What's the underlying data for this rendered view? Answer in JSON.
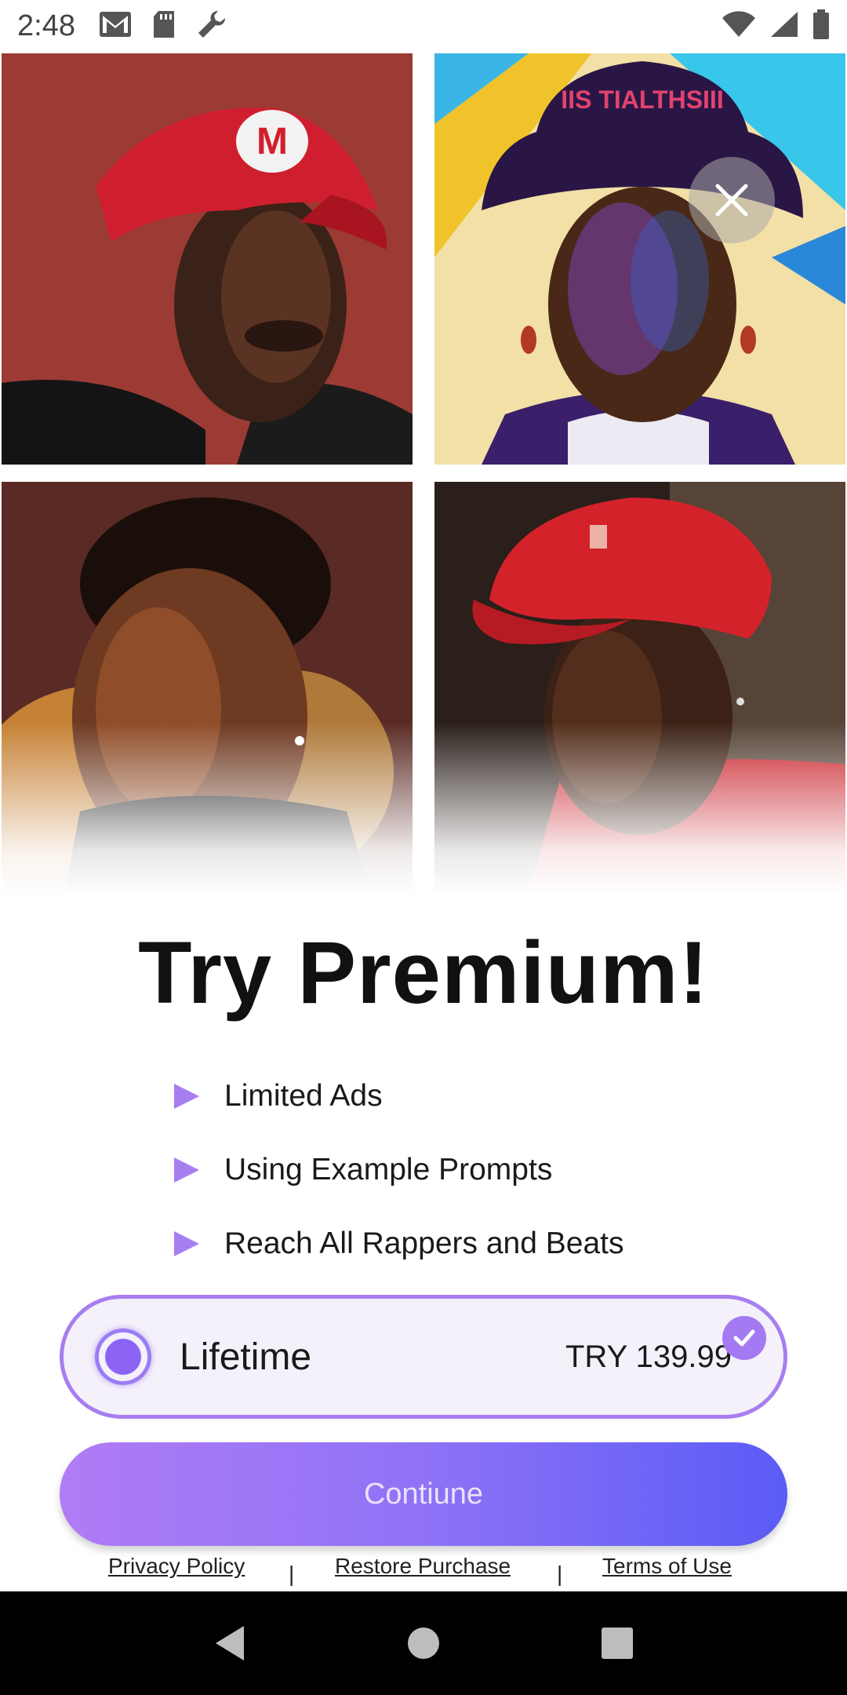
{
  "status_bar": {
    "time": "2:48",
    "left_icons": [
      "gmail-icon",
      "sd-card-icon",
      "wrench-icon"
    ],
    "right_icons": [
      "wifi-icon",
      "signal-icon",
      "battery-icon"
    ]
  },
  "gallery": {
    "images": [
      "portrait-red-cap-m-logo",
      "portrait-blue-hat-neon",
      "portrait-warm-light",
      "portrait-red-cap"
    ]
  },
  "paywall": {
    "title": "Try Premium!",
    "features": [
      "Limited Ads",
      "Using Example Prompts",
      "Reach All Rappers and Beats"
    ],
    "plan": {
      "name": "Lifetime",
      "price": "TRY 139.99",
      "selected": true
    },
    "continue_label": "Contiune",
    "links": {
      "privacy": "Privacy Policy",
      "restore": "Restore Purchase",
      "terms": "Terms of Use",
      "separator": "|"
    }
  },
  "colors": {
    "accent": "#a77ef0",
    "button_start": "#b07cf5",
    "button_end": "#5a5cf6"
  }
}
